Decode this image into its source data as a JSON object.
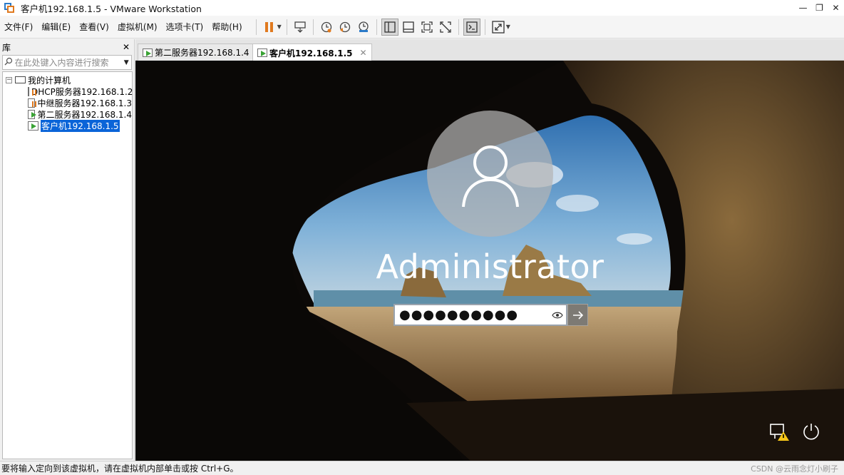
{
  "window": {
    "title": "客户机192.168.1.5 - VMware Workstation",
    "controls": [
      "—",
      "❐",
      "✕"
    ]
  },
  "menu": [
    "文件(F)",
    "编辑(E)",
    "查看(V)",
    "虚拟机(M)",
    "选项卡(T)",
    "帮助(H)"
  ],
  "library": {
    "title": "库",
    "close": "✕",
    "search_placeholder": "在此处键入内容进行搜索",
    "root": "我的计算机",
    "items": [
      {
        "label": "DHCP服务器192.168.1.2",
        "state": "paused"
      },
      {
        "label": "中继服务器192.168.1.3",
        "state": "paused"
      },
      {
        "label": "第二服务器192.168.1.4",
        "state": "running"
      },
      {
        "label": "客户机192.168.1.5",
        "state": "running",
        "selected": true
      }
    ]
  },
  "tabs": [
    {
      "label": "第二服务器192.168.1.4",
      "active": false
    },
    {
      "label": "客户机192.168.1.5",
      "active": true
    }
  ],
  "vm_screen": {
    "username": "Administrator",
    "password_mask": "●●●●●●●●●●"
  },
  "status": {
    "message": "要将输入定向到该虚拟机，请在虚拟机内部单击或按 Ctrl+G。",
    "watermark": "CSDN @云雨念灯小刷子"
  },
  "colors": {
    "accent_orange": "#e07a1f",
    "running_green": "#3aa335",
    "selection_blue": "#0a64d8"
  }
}
